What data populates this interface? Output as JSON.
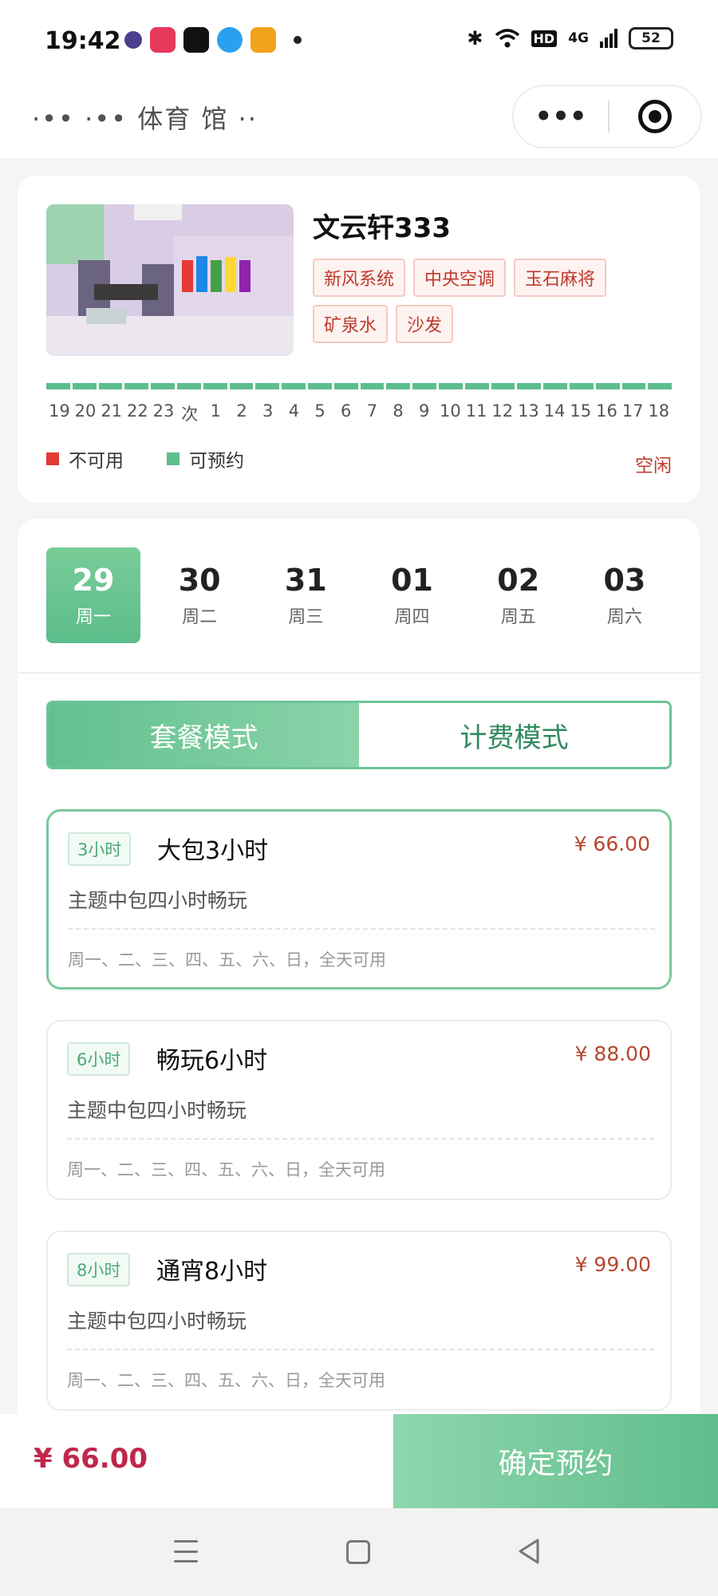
{
  "status_bar": {
    "time": "19:42",
    "network": "4G",
    "battery": "52"
  },
  "nav": {
    "title": "·•• ·•• 体育 馆 ··"
  },
  "room": {
    "name": "文云轩333",
    "tags": [
      "新风系统",
      "中央空调",
      "玉石麻将",
      "矿泉水",
      "沙发"
    ],
    "timeline_hours": [
      "19",
      "20",
      "21",
      "22",
      "23",
      "次",
      "1",
      "2",
      "3",
      "4",
      "5",
      "6",
      "7",
      "8",
      "9",
      "10",
      "11",
      "12",
      "13",
      "14",
      "15",
      "16",
      "17",
      "18"
    ],
    "legend_unavailable": "不可用",
    "legend_available": "可预约",
    "status_text": "空闲"
  },
  "dates": [
    {
      "day": "29",
      "week": "周一"
    },
    {
      "day": "30",
      "week": "周二"
    },
    {
      "day": "31",
      "week": "周三"
    },
    {
      "day": "01",
      "week": "周四"
    },
    {
      "day": "02",
      "week": "周五"
    },
    {
      "day": "03",
      "week": "周六"
    }
  ],
  "modes": {
    "package": "套餐模式",
    "billing": "计费模式"
  },
  "packages": [
    {
      "badge": "3小时",
      "title": "大包3小时",
      "price": "¥ 66.00",
      "desc": "主题中包四小时畅玩",
      "days": "周一、二、三、四、五、六、日，全天可用"
    },
    {
      "badge": "6小时",
      "title": "畅玩6小时",
      "price": "¥ 88.00",
      "desc": "主题中包四小时畅玩",
      "days": "周一、二、三、四、五、六、日，全天可用"
    },
    {
      "badge": "8小时",
      "title": "通宵8小时",
      "price": "¥ 99.00",
      "desc": "主题中包四小时畅玩",
      "days": "周一、二、三、四、五、六、日，全天可用"
    }
  ],
  "bottom": {
    "total": "¥ 66.00",
    "confirm": "确定预约"
  },
  "colors": {
    "accent": "#5dbd8c",
    "unavailable": "#e53935",
    "price": "#c0264a"
  }
}
